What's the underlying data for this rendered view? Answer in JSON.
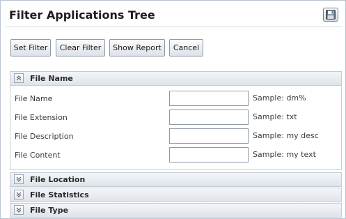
{
  "window": {
    "title": "Filter Applications Tree",
    "save_icon": "floppy-disk-icon"
  },
  "toolbar": {
    "set_filter": "Set Filter",
    "clear_filter": "Clear Filter",
    "show_report": "Show Report",
    "cancel": "Cancel"
  },
  "sections": {
    "file_name": {
      "label": "File Name",
      "expanded": true,
      "fields": [
        {
          "label": "File Name",
          "value": "",
          "sample": "Sample: dm%"
        },
        {
          "label": "File Extension",
          "value": "",
          "sample": "Sample: txt"
        },
        {
          "label": "File Description",
          "value": "",
          "sample": "Sample: my desc"
        },
        {
          "label": "File Content",
          "value": "",
          "sample": "Sample: my text"
        }
      ]
    },
    "file_location": {
      "label": "File Location",
      "expanded": false
    },
    "file_statistics": {
      "label": "File Statistics",
      "expanded": false
    },
    "file_type": {
      "label": "File Type",
      "expanded": false
    }
  }
}
